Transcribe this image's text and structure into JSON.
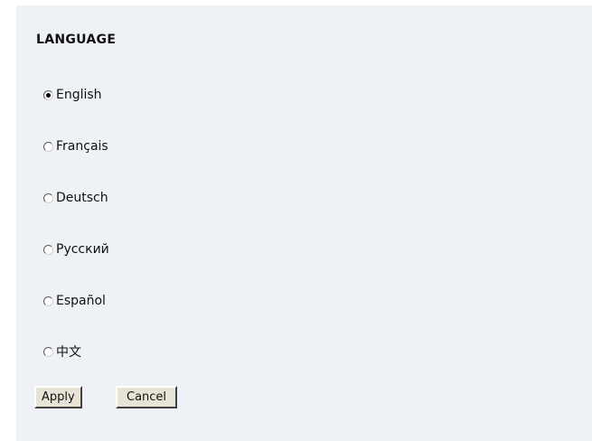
{
  "section": {
    "title": "LANGUAGE"
  },
  "languages": [
    {
      "label": "English",
      "selected": true
    },
    {
      "label": "Français",
      "selected": false
    },
    {
      "label": "Deutsch",
      "selected": false
    },
    {
      "label": "Русский",
      "selected": false
    },
    {
      "label": "Español",
      "selected": false
    },
    {
      "label": "中文",
      "selected": false
    }
  ],
  "buttons": {
    "apply": "Apply",
    "cancel": "Cancel"
  }
}
